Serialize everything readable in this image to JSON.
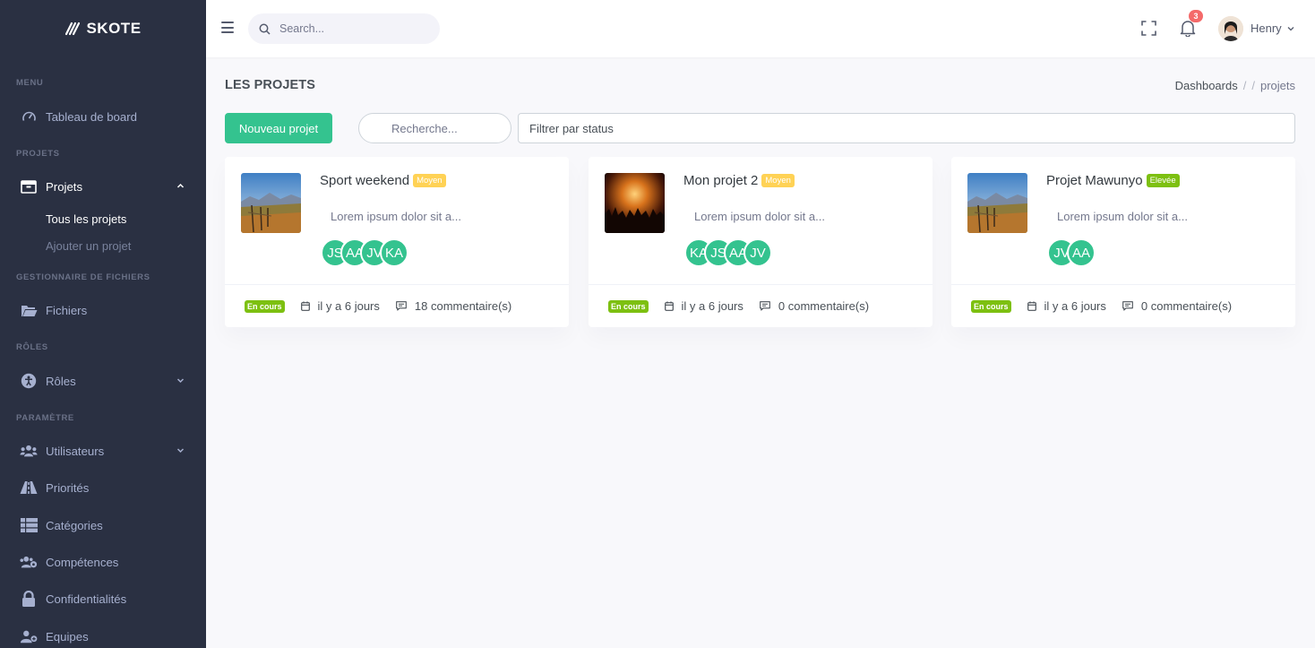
{
  "brand": {
    "name": "SKOTE"
  },
  "sidebar": {
    "sections": [
      "MENU",
      "PROJETS",
      "GESTIONNAIRE DE FICHIERS",
      "RÔLES",
      "PARAMÈTRE"
    ],
    "items": [
      {
        "label": "Tableau de board",
        "icon": "dashboard-icon"
      },
      {
        "label": "Projets",
        "icon": "briefcase-icon"
      },
      {
        "label": "Fichiers",
        "icon": "folder-icon"
      },
      {
        "label": "Rôles",
        "icon": "accessibility-icon"
      },
      {
        "label": "Utilisateurs",
        "icon": "users-icon"
      },
      {
        "label": "Priorités",
        "icon": "road-icon"
      },
      {
        "label": "Catégories",
        "icon": "list-icon"
      },
      {
        "label": "Compétences",
        "icon": "users-cog-icon"
      },
      {
        "label": "Confidentialités",
        "icon": "lock-icon"
      },
      {
        "label": "Equipes",
        "icon": "user-plus-icon"
      }
    ],
    "subitems": [
      "Tous les projets",
      "Ajouter un projet"
    ]
  },
  "topbar": {
    "search_placeholder": "Search...",
    "notification_count": "3",
    "user_name": "Henry"
  },
  "page": {
    "title": "LES PROJETS",
    "breadcrumb": [
      "Dashboards",
      "/",
      "/",
      "projets"
    ],
    "new_button": "Nouveau projet",
    "search_placeholder": "Recherche...",
    "status_filter": "Filtrer par status"
  },
  "colors": {
    "sidebar": "#2a3042",
    "success": "#34c38f",
    "warning": "#f1b44c",
    "high": "#7dc011",
    "badge_red": "#f46a6a"
  },
  "projects": [
    {
      "title": "Sport weekend",
      "priority": "Moyen",
      "priority_color": "#ffd255",
      "description": "Lorem ipsum dolor sit a...",
      "members": [
        "JS",
        "AA",
        "JV",
        "KA"
      ],
      "status": "En cours",
      "date": "il y a 6 jours",
      "comments": "18 commentaire(s)"
    },
    {
      "title": "Mon projet 2",
      "priority": "Moyen",
      "priority_color": "#ffd255",
      "description": "Lorem ipsum dolor sit a...",
      "members": [
        "KA",
        "JS",
        "AA",
        "JV"
      ],
      "status": "En cours",
      "date": "il y a 6 jours",
      "comments": "0 commentaire(s)"
    },
    {
      "title": "Projet Mawunyo",
      "priority": "Elevée",
      "priority_color": "#7dc011",
      "description": "Lorem ipsum dolor sit a...",
      "members": [
        "JV",
        "AA"
      ],
      "status": "En cours",
      "date": "il y a 6 jours",
      "comments": "0 commentaire(s)"
    }
  ]
}
